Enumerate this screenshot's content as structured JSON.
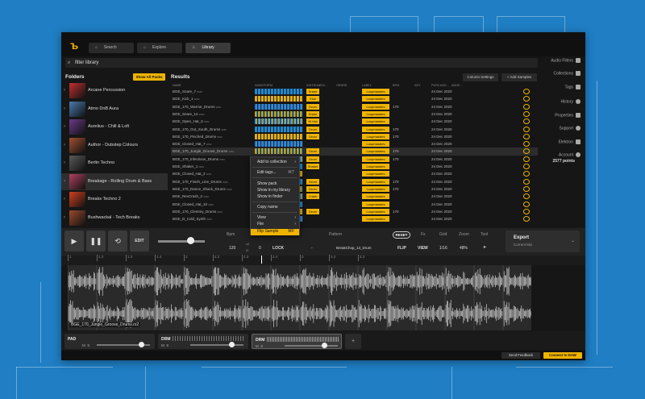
{
  "topbar": {
    "tabs": [
      {
        "label": "Search",
        "icon": "search-icon"
      },
      {
        "label": "Explore",
        "icon": "explore-icon"
      },
      {
        "label": "Library",
        "icon": "user-icon"
      }
    ]
  },
  "filter": {
    "placeholder": "filter library"
  },
  "right_sidebar": {
    "items": [
      {
        "label": "Audio Filters",
        "icon": "filter-icon"
      },
      {
        "label": "Collections",
        "icon": "collections-icon"
      },
      {
        "label": "Tags",
        "icon": "tag-icon"
      },
      {
        "label": "History",
        "icon": "history-icon"
      },
      {
        "label": "Properties",
        "icon": "pencil-icon"
      },
      {
        "label": "Support",
        "icon": "help-icon"
      },
      {
        "label": "Elektron",
        "icon": "elektron-icon"
      },
      {
        "label": "Account",
        "icon": "account-icon"
      }
    ],
    "account_points": "2577 points"
  },
  "folders": {
    "heading": "Folders",
    "show_all": "Show All Packs",
    "items": [
      {
        "name": "Arcane Percussion",
        "color": "#c03030"
      },
      {
        "name": "Atmo DnB Aura",
        "color": "#4a7ab0"
      },
      {
        "name": "Aurelius - Chill & Lofi",
        "color": "#6a3a8a"
      },
      {
        "name": "Author - Dubstep Colours",
        "color": "#a05030"
      },
      {
        "name": "Berlin Techno",
        "color": "#5a5a5a"
      },
      {
        "name": "Breakage - Rolling Drum & Bass",
        "color": "#b04060"
      },
      {
        "name": "Breaks Techno 2",
        "color": "#d04020"
      },
      {
        "name": "Bushwackal - Tech Breaks",
        "color": "#9a4a2a"
      }
    ]
  },
  "results": {
    "heading": "Results",
    "column_settings": "Column Settings",
    "add_samples": "+ Add Samples",
    "columns": [
      "NAME",
      "WAVEFORM",
      "INSTRUMEN...",
      "GENRE",
      "LABEL",
      "BPM",
      "KEY",
      "PURCHAS...",
      "ADDE..."
    ],
    "rows": [
      {
        "name": "BGE_Snare_7",
        "ext": "wav",
        "inst": "Snare",
        "label": "Loopmasters",
        "bpm": "",
        "date": "24 Dec 2020"
      },
      {
        "name": "BGE_Kick_1",
        "ext": "wav",
        "inst": "Kick",
        "label": "Loopmasters",
        "bpm": "",
        "date": "24 Dec 2020"
      },
      {
        "name": "BGE_170_Warrior_Drums",
        "ext": "wav",
        "inst": "Drum",
        "label": "Loopmasters",
        "bpm": "170",
        "date": "24 Dec 2020"
      },
      {
        "name": "BGE_Snare_14",
        "ext": "wav",
        "inst": "Snare",
        "label": "Loopmasters",
        "bpm": "",
        "date": "24 Dec 2020"
      },
      {
        "name": "BGE_Open_Hat_3",
        "ext": "wav",
        "inst": "Hi Hat",
        "label": "Loopmasters",
        "bpm": "",
        "date": "24 Dec 2020"
      },
      {
        "name": "BGE_170_Out_South_Drums",
        "ext": "wav",
        "inst": "Drum",
        "label": "Loopmasters",
        "bpm": "170",
        "date": "24 Dec 2020"
      },
      {
        "name": "BGE_170_Pinched_Drums",
        "ext": "wav",
        "inst": "Drum",
        "label": "Loopmasters",
        "bpm": "170",
        "date": "24 Dec 2020"
      },
      {
        "name": "BGE_Closed_Hat_7",
        "ext": "wav",
        "inst": "",
        "label": "Loopmasters",
        "bpm": "",
        "date": "24 Dec 2020"
      },
      {
        "name": "BGE_170_Jungle_Groove_Drums",
        "ext": "wav",
        "inst": "Drum",
        "label": "Loopmasters",
        "bpm": "170",
        "date": "24 Dec 2020"
      },
      {
        "name": "BGE_170_Infectious_Drums",
        "ext": "wav",
        "inst": "Drum",
        "label": "Loopmasters",
        "bpm": "170",
        "date": "24 Dec 2020"
      },
      {
        "name": "BGE_Shaker_1",
        "ext": "wav",
        "inst": "Shaker",
        "label": "Loopmasters",
        "bpm": "",
        "date": "24 Dec 2020"
      },
      {
        "name": "BGE_Closed_Hat_2",
        "ext": "wav",
        "inst": "",
        "label": "Loopmasters",
        "bpm": "",
        "date": "24 Dec 2020"
      },
      {
        "name": "BGE_170_Finish_Line_Drums",
        "ext": "wav",
        "inst": "Drum",
        "label": "Loopmasters",
        "bpm": "170",
        "date": "24 Dec 2020"
      },
      {
        "name": "BGE_170_Dance_Shack_Drums",
        "ext": "wav",
        "inst": "Drum",
        "label": "Loopmasters",
        "bpm": "170",
        "date": "24 Dec 2020"
      },
      {
        "name": "BGE_RevCrash_2",
        "ext": "wav",
        "inst": "Crash",
        "label": "Loopmasters",
        "bpm": "",
        "date": "24 Dec 2020"
      },
      {
        "name": "BGE_Closed_Hat_10",
        "ext": "wav",
        "inst": "",
        "label": "Loopmasters",
        "bpm": "",
        "date": "24 Dec 2020"
      },
      {
        "name": "BGE_170_Clemmy_Drums",
        "ext": "wav",
        "inst": "Drum",
        "label": "Loopmasters",
        "bpm": "170",
        "date": "24 Dec 2020"
      },
      {
        "name": "BGE_D_Cold_Synth",
        "ext": "wav",
        "inst": "",
        "label": "Loopmasters",
        "bpm": "",
        "date": "24 Dec 2020"
      }
    ]
  },
  "context_menu": {
    "items": [
      "Add to collection",
      "Edit tags...",
      "Show pack",
      "Show in my library",
      "Show in finder",
      "Copy name",
      "View",
      "File",
      "Flip Sample"
    ],
    "edit_shortcut": "⌘T",
    "flip_shortcut": "⌘F"
  },
  "controls": {
    "edit": "EDIT",
    "bpm_label": "Bpm",
    "bpm": "120",
    "pitch_val": "0",
    "lock": "LOCK",
    "dash": "-",
    "pattern_label": "Pattern",
    "pattern": "BreakChop_13_Drum",
    "reset": "RESET",
    "fx_label": "Fx",
    "fx": "FLIP",
    "grid_label": "Grid",
    "grid": "1/16",
    "zoom_label": "Zoom",
    "zoom": "48%",
    "tool_label": "Tool",
    "x2": "x2",
    "div2": "/2",
    "export_title": "Export",
    "export_sub": "Current Mix"
  },
  "ruler": {
    "marks": [
      "1",
      "1.2",
      "1.3",
      "1.4",
      "2",
      "2.2",
      "2.3",
      "2.4",
      "3",
      "3.2",
      "3.3"
    ]
  },
  "waveform": {
    "name": "BGE_170_Jungle_Groove_Drums.rx2"
  },
  "pads": [
    {
      "label": "PAD",
      "m": "M",
      "s": "S"
    },
    {
      "label": "DRM",
      "m": "M",
      "s": "S"
    },
    {
      "label": "DRM",
      "m": "M",
      "s": "S"
    }
  ],
  "pad_add": "+",
  "footer": {
    "feedback": "Send Feedback",
    "connect": "Connect to DAW"
  }
}
